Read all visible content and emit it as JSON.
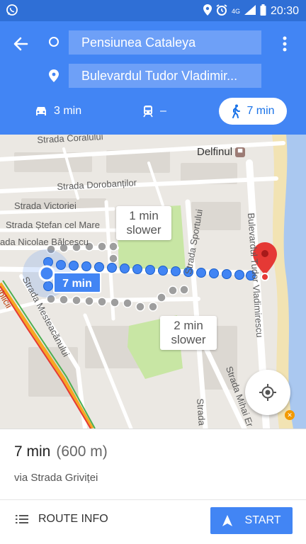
{
  "status_bar": {
    "network": "4G",
    "time": "20:30"
  },
  "header": {
    "origin": "Pensiunea Cataleya",
    "destination": "Bulevardul Tudor Vladimir...",
    "modes": [
      {
        "name": "car",
        "label": "3 min",
        "icon": "car-icon"
      },
      {
        "name": "transit",
        "label": "–",
        "icon": "train-icon"
      },
      {
        "name": "walk",
        "label": "7 min",
        "icon": "walking-icon",
        "selected": true
      }
    ]
  },
  "map": {
    "poi": "Delfinul",
    "streets": [
      "Strada Coralului",
      "Strada Dorobanților",
      "Strada Victoriei",
      "Strada Ștefan cel Mare",
      "ada Nicolae Bălcescu",
      "Strada Mesteacănului",
      "Strada Sportului",
      "Bulevardul Tudor Vladimirescu",
      "Strada Mihai Er",
      "Strada",
      "ublicii"
    ],
    "route_label": "7 min",
    "alternatives": [
      {
        "line1": "1 min",
        "line2": "slower"
      },
      {
        "line1": "2 min",
        "line2": "slower"
      }
    ],
    "colors": {
      "route": "#4285f4",
      "alt_route": "#9e9e9e",
      "park": "#c8e6a4",
      "water": "#aac8f0",
      "beach": "#f2e3b3",
      "destination_pin": "#e53935"
    }
  },
  "summary": {
    "duration": "7 min",
    "distance": "(600 m)",
    "via": "via Strada Griviței"
  },
  "actions": {
    "route_info": "ROUTE INFO",
    "start": "START"
  }
}
